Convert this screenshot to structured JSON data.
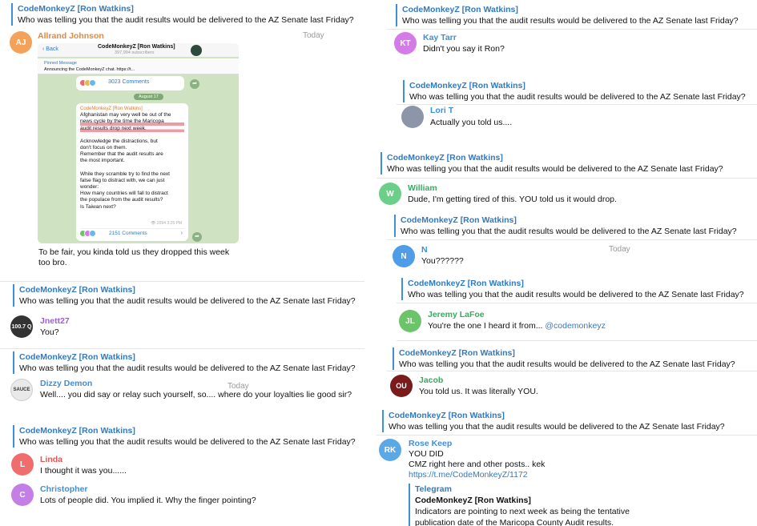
{
  "quote": {
    "author": "CodeMonkeyZ [Ron Watkins]",
    "text": "Who was telling you that the audit results would be delivered to the AZ Senate last Friday?"
  },
  "left": {
    "m1": {
      "initials": "AJ",
      "name": "Allrand Johnson",
      "time": "Today",
      "text": [
        "To be fair, you kinda told us they dropped this week",
        "too bro."
      ],
      "screenshot": {
        "back": "Back",
        "title": "CodeMonkeyZ [Ron Watkins]",
        "subscribers": "397,994 subscribers",
        "pinned_label": "Pinned Message",
        "pinned_text": "Announcing the CodeMonkeyZ chat. https://t...",
        "comments1": "3023 Comments",
        "date": "August 17",
        "post_author": "CodeMonkeyZ [Ron Watkins]",
        "post_lines": [
          "Afghanistan may very well be out of the",
          "news cycle by the time the Maricopa",
          "audit results drop next week.",
          "",
          "Acknowledge the distractions, but",
          "don't focus on them.",
          "Remember that the audit results are",
          "the most important.",
          "",
          "While they scramble try to find the next",
          "false flag to distract with, we can just",
          "wonder:",
          "How many countries will fall to distract",
          "the populace from the audit results?",
          "Is Taiwan next?"
        ],
        "post_time": "2094 3:25 PM",
        "comments2": "2151 Comments"
      }
    },
    "m2": {
      "name": "Jnett27",
      "text": "You?",
      "avatar_text": "100.7 Q"
    },
    "m3": {
      "name": "Dizzy Demon",
      "time": "Today",
      "text": "Well.... you did say or relay such yourself, so.... where do your loyalties lie good sir?"
    },
    "m4": {
      "initials": "L",
      "name": "Linda",
      "text": "I thought it was you......"
    },
    "m5": {
      "initials": "C",
      "name": "Christopher",
      "text": "Lots of people did. You implied it. Why the finger pointing?"
    }
  },
  "right": {
    "m1": {
      "initials": "KT",
      "name": "Kay Tarr",
      "text": "Didn't you say it Ron?"
    },
    "m2": {
      "name": "Lori T",
      "text": "Actually you told us...."
    },
    "m3": {
      "initials": "W",
      "name": "William",
      "text": "Dude, I'm getting tired of this. YOU told us it would drop."
    },
    "m4": {
      "initials": "N",
      "name": "N",
      "time": "Today",
      "text": "You??????"
    },
    "m5": {
      "initials": "JL",
      "name": "Jeremy LaFoe",
      "text": "You're the one I heard it from...",
      "mention": "@codemonkeyz"
    },
    "m6": {
      "name": "Jacob",
      "text": "You told us. It was literally YOU.",
      "avatar_text": "OU"
    },
    "m7": {
      "initials": "RK",
      "name": "Rose Keep",
      "lines": [
        "YOU DID",
        "CMZ right here and other posts.. kek"
      ],
      "link": "https://t.me/CodeMonkeyZ/1172",
      "preview": {
        "site": "Telegram",
        "title": "CodeMonkeyZ [Ron Watkins]",
        "desc": [
          "Indicators are pointing to next week as being the tentative",
          "publication date of the Maricopa County Audit results."
        ]
      }
    }
  },
  "colors": {
    "accent": "#2f7ac4",
    "aj": "#f4a259",
    "kt": "#d57be8",
    "w": "#6bcf8a",
    "n": "#4e9de6",
    "jl": "#6bc46a",
    "l": "#f06d6d",
    "c": "#c57ee6",
    "rk": "#5aa9e6"
  }
}
